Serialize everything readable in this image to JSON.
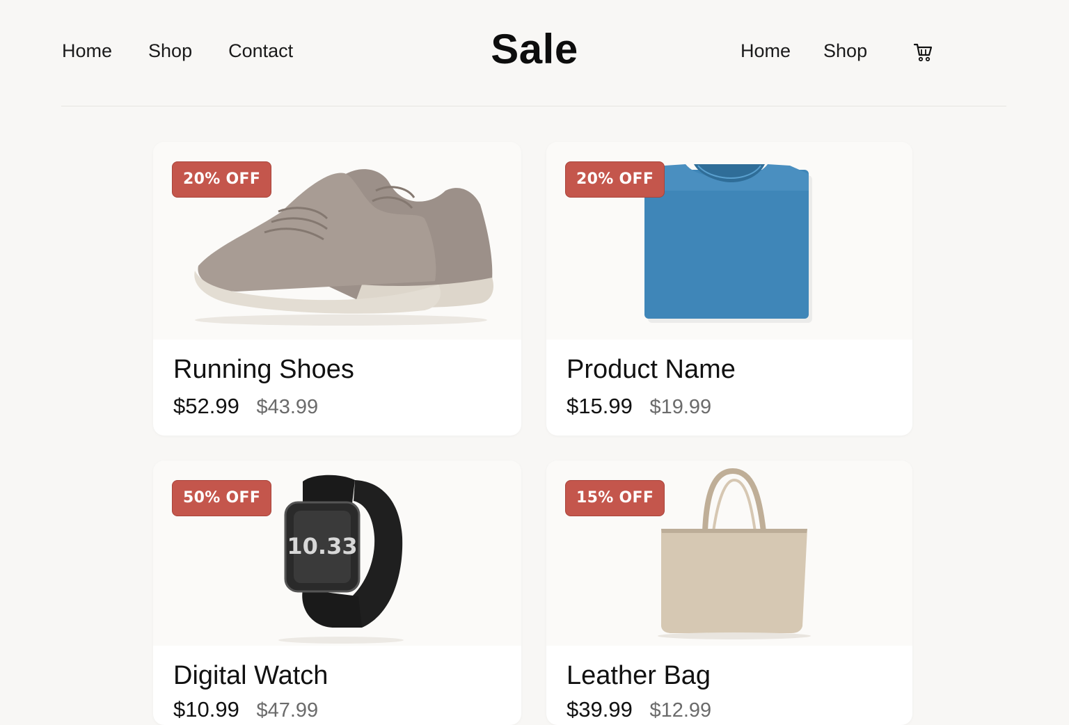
{
  "header": {
    "title": "Sale",
    "nav_left": [
      "Home",
      "Shop",
      "Contact"
    ],
    "nav_right": [
      "Home",
      "Shop"
    ],
    "cart_icon": "shopping-cart-icon"
  },
  "colors": {
    "background": "#f8f7f5",
    "card": "#ffffff",
    "badge": "#c4564c",
    "text": "#111111",
    "muted": "#6b6b6b"
  },
  "products": [
    {
      "badge": "20% OFF",
      "name": "Running Shoes",
      "price": "$52.99",
      "original_price": "$43.99",
      "image": "running-shoes"
    },
    {
      "badge": "20% OFF",
      "name": "Product Name",
      "price": "$15.99",
      "original_price": "$19.99",
      "image": "blue-tshirt"
    },
    {
      "badge": "50% OFF",
      "name": "Digital Watch",
      "price": "$10.99",
      "original_price": "$47.99",
      "image": "digital-watch",
      "watch_display": "10.33"
    },
    {
      "badge": "15% OFF",
      "name": "Leather Bag",
      "price": "$39.99",
      "original_price": "$12.99",
      "image": "leather-tote-bag"
    }
  ]
}
